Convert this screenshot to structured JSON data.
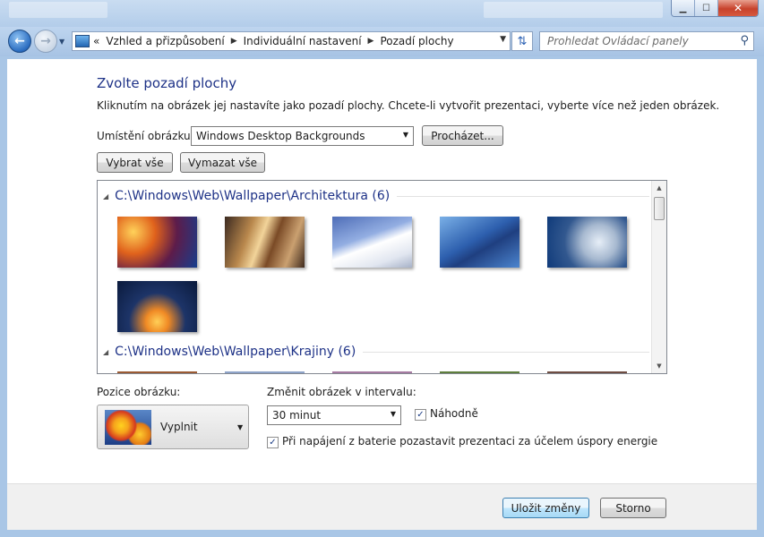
{
  "window": {
    "minimize": "▁",
    "maximize": "☐",
    "close": "✕"
  },
  "address": {
    "overflow": "«",
    "crumbs": [
      "Vzhled a přizpůsobení",
      "Individuální nastavení",
      "Pozadí plochy"
    ]
  },
  "search": {
    "placeholder": "Prohledat Ovládací panely"
  },
  "page": {
    "title": "Zvolte pozadí plochy",
    "description": "Kliknutím na obrázek jej nastavíte jako pozadí plochy. Chcete-li vytvořit prezentaci, vyberte více než jeden obrázek."
  },
  "location": {
    "label": "Umístění obrázku:",
    "value": "Windows Desktop Backgrounds",
    "browse": "Procházet..."
  },
  "select_all": "Vybrat vše",
  "clear_all": "Vymazat vše",
  "groups": [
    {
      "title": "C:\\Windows\\Web\\Wallpaper\\Architektura (6)",
      "count": 6
    },
    {
      "title": "C:\\Windows\\Web\\Wallpaper\\Krajiny (6)",
      "count": 6
    }
  ],
  "position": {
    "label": "Pozice obrázku:",
    "value": "Vyplnit"
  },
  "interval": {
    "label": "Změnit obrázek v intervalu:",
    "value": "30 minut"
  },
  "shuffle": {
    "label": "Náhodně",
    "checked": true
  },
  "battery": {
    "label": "Při napájení z baterie pozastavit prezentaci za účelem úspory energie",
    "checked": true
  },
  "footer": {
    "save": "Uložit změny",
    "cancel": "Storno"
  }
}
